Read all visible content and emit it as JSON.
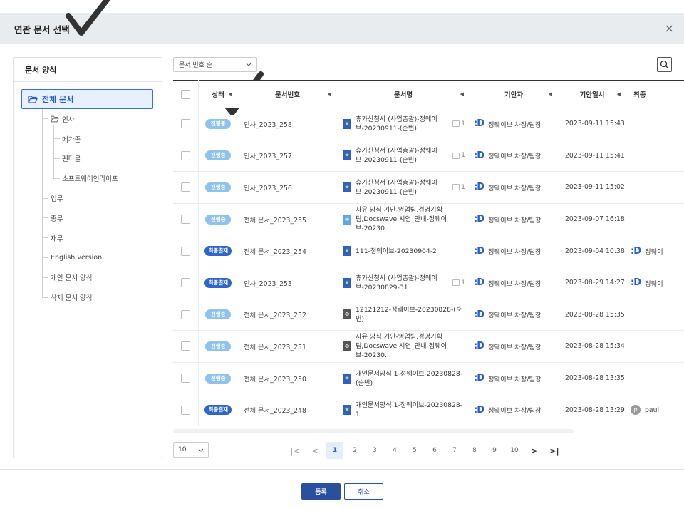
{
  "header": {
    "title": "연관 문서 선택",
    "close": "×"
  },
  "sidebar": {
    "title": "문서 양식",
    "root": "전체 문서",
    "items": [
      {
        "label": "인사",
        "level": 1,
        "folder": true
      },
      {
        "label": "메가존",
        "level": 2
      },
      {
        "label": "펜타클",
        "level": 2
      },
      {
        "label": "소프트웨어인라이프",
        "level": 2
      },
      {
        "label": "업무",
        "level": 1
      },
      {
        "label": "총무",
        "level": 1
      },
      {
        "label": "재무",
        "level": 1
      },
      {
        "label": "English version",
        "level": 1
      },
      {
        "label": "개인 문서 양식",
        "level": 1
      },
      {
        "label": "삭제 문서 양식",
        "level": 1
      }
    ]
  },
  "toolbar": {
    "sort_label": "문서 번호 순"
  },
  "table": {
    "columns": [
      "상태",
      "문서번호",
      "문서명",
      "기안자",
      "기안일시",
      "최종"
    ],
    "rows": [
      {
        "status": "진행중",
        "status_type": "prog",
        "doc_no": "인사_2023_258",
        "title": "휴가신청서 (사업총괄)-정웨이브-20230911-(순번)",
        "icon": "star",
        "count": "1",
        "drafter": "정웨이브 차장/팀장",
        "date": "2023-09-11 15:43",
        "final": ""
      },
      {
        "status": "진행중",
        "status_type": "prog",
        "doc_no": "인사_2023_257",
        "title": "휴가신청서 (사업총괄)-정웨이브-20230911-(순번)",
        "icon": "star",
        "count": "1",
        "drafter": "정웨이브 차장/팀장",
        "date": "2023-09-11 15:41",
        "final": ""
      },
      {
        "status": "진행중",
        "status_type": "prog",
        "doc_no": "인사_2023_256",
        "title": "휴가신청서 (사업총괄)-정웨이브-20230911-(순번)",
        "icon": "star",
        "count": "1",
        "drafter": "정웨이브 차장/팀장",
        "date": "2023-09-11 15:02",
        "final": ""
      },
      {
        "status": "진행중",
        "status_type": "prog",
        "doc_no": "전체 문서_2023_255",
        "title": "자유 양식 기안-영업팀,경영기획팀,Docswave 시연_안내-정웨이브-20230...",
        "icon": "lines",
        "count": "",
        "drafter": "정웨이브 차장/팀장",
        "date": "2023-09-07 16:18",
        "final": ""
      },
      {
        "status": "최종결재",
        "status_type": "final",
        "doc_no": "전체 문서_2023_254",
        "title": "111-정웨이브-20230904-2",
        "icon": "star",
        "count": "",
        "drafter": "정웨이브 차장/팀장",
        "date": "2023-09-04 10:38",
        "final": "정웨이",
        "final_icon": "d"
      },
      {
        "status": "최종결재",
        "status_type": "final",
        "doc_no": "인사_2023_253",
        "title": "휴가신청서 (사업총괄)-정웨이브-20230829-31",
        "icon": "star",
        "count": "1",
        "drafter": "정웨이브 차장/팀장",
        "date": "2023-08-29 14:27",
        "final": "정웨이",
        "final_icon": "d"
      },
      {
        "status": "진행중",
        "status_type": "prog",
        "doc_no": "전체 문서_2023_252",
        "title": "12121212-정웨이브-20230828-(순번)",
        "icon": "globe",
        "count": "",
        "drafter": "정웨이브 차장/팀장",
        "date": "2023-08-28 15:35",
        "final": ""
      },
      {
        "status": "진행중",
        "status_type": "prog",
        "doc_no": "전체 문서_2023_251",
        "title": "자유 양식 기안-영업팀,경영기획팀,Docswave 시연_안내-정웨이브-20230...",
        "icon": "globe",
        "count": "",
        "drafter": "정웨이브 차장/팀장",
        "date": "2023-08-28 15:34",
        "final": ""
      },
      {
        "status": "진행중",
        "status_type": "prog",
        "doc_no": "전체 문서_2023_250",
        "title": "개인문서양식 1-정웨이브-20230828-(순번)",
        "icon": "star",
        "count": "",
        "drafter": "정웨이브 차장/팀장",
        "date": "2023-08-28 13:35",
        "final": ""
      },
      {
        "status": "최종결재",
        "status_type": "final",
        "doc_no": "전체 문서_2023_248",
        "title": "개인문서양식 1-정웨이브-20230828-1",
        "icon": "star",
        "count": "",
        "drafter": "정웨이브 차장/팀장",
        "date": "2023-08-28 13:29",
        "final": "paul",
        "final_icon": "p"
      }
    ]
  },
  "pagination": {
    "page_size": "10",
    "pages": [
      "1",
      "2",
      "3",
      "4",
      "5",
      "6",
      "7",
      "8",
      "9",
      "10"
    ],
    "current": "1",
    "first": "|<",
    "prev": "<",
    "next": ">",
    "last": ">|"
  },
  "footer": {
    "ok": "등록",
    "cancel": "취소"
  },
  "colors": {
    "accent": "#2a62c9",
    "header_bg": "#e9ecef",
    "badge_progress": "#8fc3ee",
    "badge_final": "#2f64c8",
    "button_primary": "#2a4f9c"
  }
}
